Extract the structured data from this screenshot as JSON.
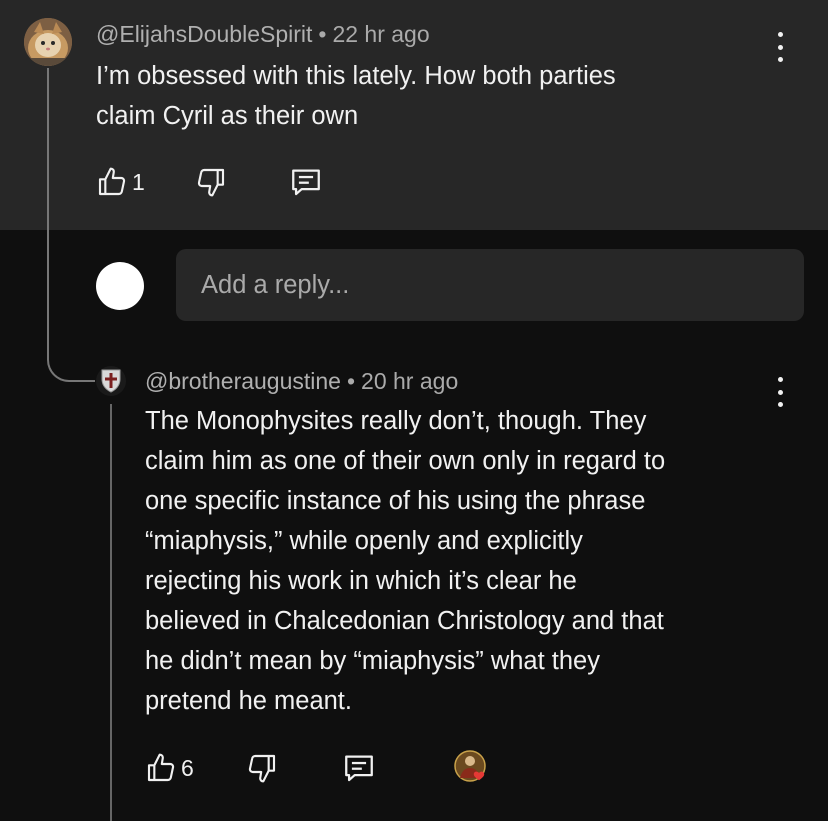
{
  "comment1": {
    "handle": "@ElijahsDoubleSpirit",
    "time": "22 hr ago",
    "separator": "•",
    "lines": [
      "I’m obsessed with this lately. How both parties",
      "claim Cyril as their own"
    ],
    "like_count": "1",
    "avatar_icon": "cat-avatar"
  },
  "reply_box": {
    "placeholder": "Add a reply..."
  },
  "comment2": {
    "handle": "@brotheraugustine",
    "time": "20 hr ago",
    "separator": "•",
    "lines": [
      "The Monophysites really don’t, though. They",
      "claim him as one of their own only in regard to",
      "one specific instance of his using the phrase",
      "“miaphysis,” while openly and explicitly",
      "rejecting his work in which it’s clear he",
      "believed in Chalcedonian Christology and that",
      "he didn’t mean by “miaphysis” what they",
      "pretend he meant."
    ],
    "like_count": "6",
    "avatar_icon": "crusader-shield-avatar",
    "creator_heart_icon": "creator-heart-icon"
  },
  "colors": {
    "top_bg": "#272727",
    "page_bg": "#0f0f0f",
    "text": "#f1f1f1",
    "meta": "#aaaaaa",
    "heart": "#e53935"
  }
}
